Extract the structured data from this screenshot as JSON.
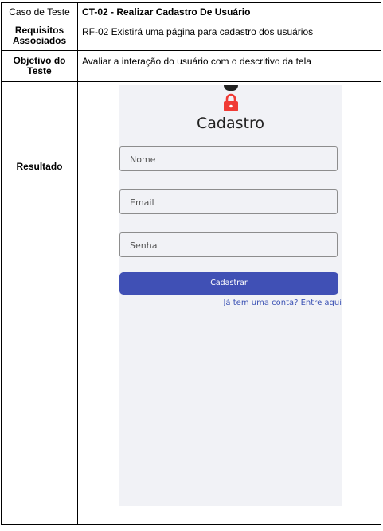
{
  "rows": {
    "caso_label": "Caso de Teste",
    "caso_value": "CT-02 - Realizar Cadastro De Usuário",
    "req_label": "Requisitos Associados",
    "req_value": "RF-02 Existirá uma página para cadastro dos usuários",
    "obj_label": "Objetivo do Teste",
    "obj_value": "Avaliar a interação do usuário com o descritivo da tela",
    "res_label": "Resultado"
  },
  "screen": {
    "title": "Cadastro",
    "icon": "lock-icon",
    "lock_color": "#f03b35",
    "name_placeholder": "Nome",
    "email_placeholder": "Email",
    "password_placeholder": "Senha",
    "submit_label": "Cadastrar",
    "login_link": "Já tem uma conta? Entre aqui",
    "button_color": "#4050b5"
  }
}
